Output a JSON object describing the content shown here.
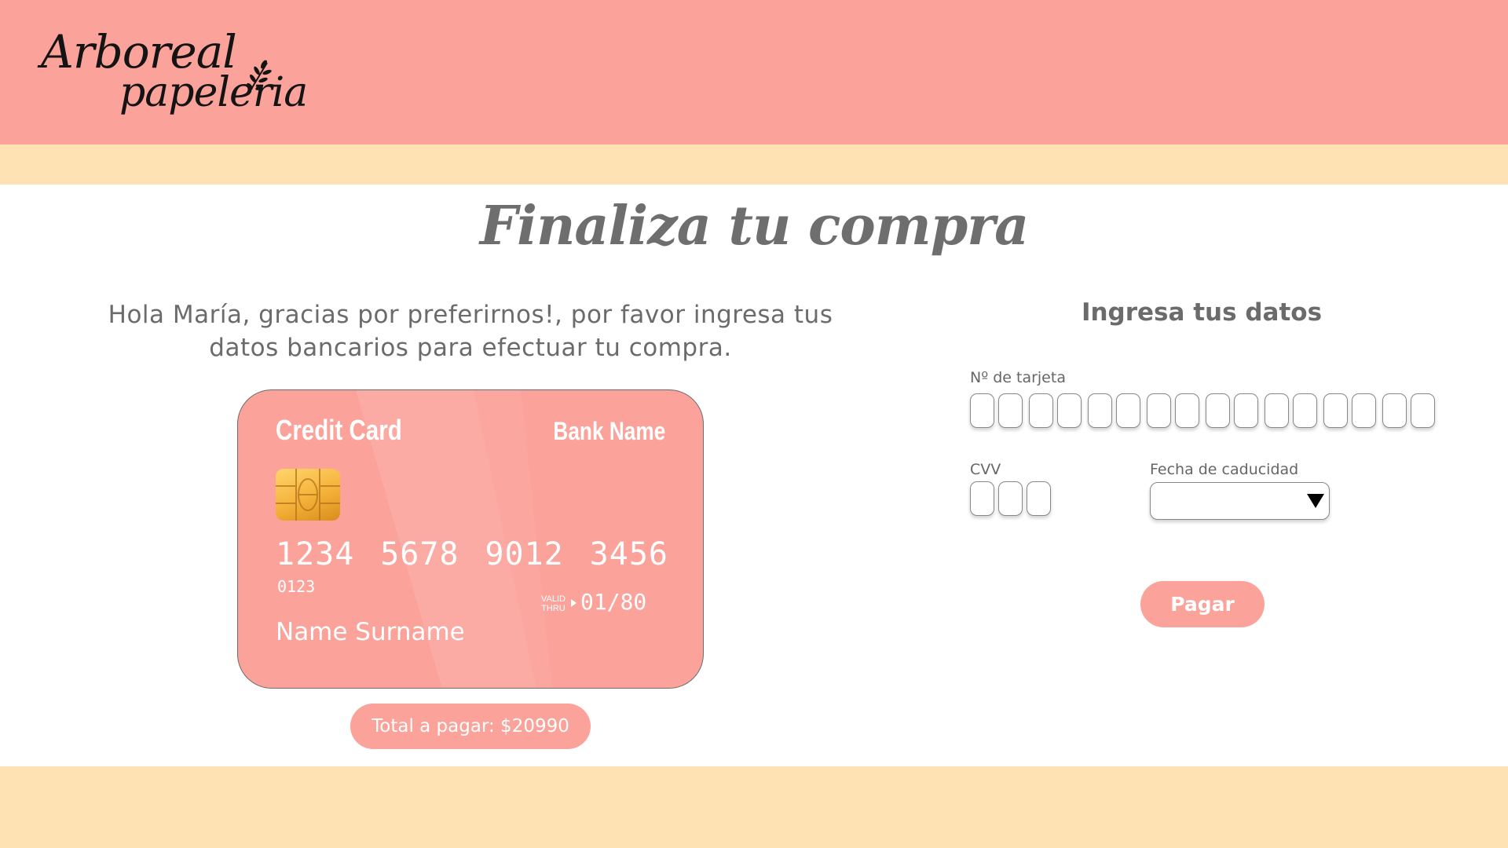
{
  "brand": {
    "logo_line1": "Arboreal",
    "logo_line2": "papeleria"
  },
  "colors": {
    "header": "#fba29a",
    "band": "#ffe2b3",
    "accent": "#fba29a",
    "text": "#666666"
  },
  "page": {
    "title": "Finaliza tu compra",
    "greeting": "Hola María, gracias por preferirnos!, por favor ingresa tus datos bancarios para efectuar tu compra."
  },
  "card": {
    "title": "Credit Card",
    "bank": "Bank Name",
    "number_groups": [
      "1234",
      "5678",
      "9012",
      "3456"
    ],
    "small_number": "0123",
    "valid_label": "VALID THRU",
    "valid_date": "01/80",
    "holder": "Name Surname",
    "chip_icon": "card-chip-icon"
  },
  "total": {
    "label": "Total a pagar: $20990"
  },
  "form": {
    "heading": "Ingresa tus datos",
    "card_number_label": "Nº de tarjeta",
    "card_number_digits": 16,
    "cvv_label": "CVV",
    "cvv_digits": 3,
    "expiry_label": "Fecha de caducidad",
    "expiry_value": "",
    "pay_button": "Pagar"
  }
}
